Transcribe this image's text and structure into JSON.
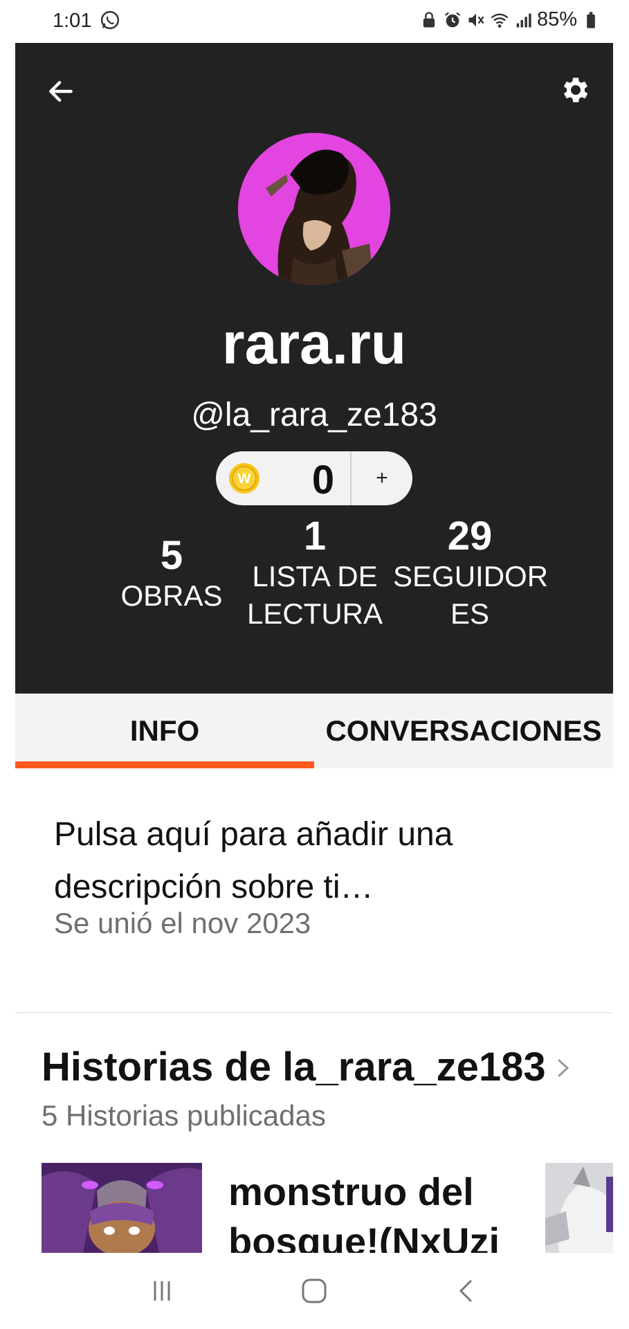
{
  "status_bar": {
    "time": "1:01",
    "battery": "85%",
    "icons": [
      "whatsapp-icon",
      "lock-icon",
      "alarm-icon",
      "mute-icon",
      "wifi-icon",
      "signal-icon",
      "battery-icon"
    ]
  },
  "header": {
    "back_icon": "arrow-left-icon",
    "settings_icon": "gear-icon",
    "display_name": "rara.ru",
    "handle": "@la_rara_ze183",
    "coins": {
      "value": "0",
      "add_label": "+",
      "icon": "coin-icon",
      "coin_letter": "W"
    },
    "stats": [
      {
        "number": "5",
        "label_lines": [
          "OBRAS"
        ]
      },
      {
        "number": "1",
        "label_lines": [
          "LISTA DE",
          "LECTURA"
        ]
      },
      {
        "number": "29",
        "label_lines": [
          "SEGUIDOR",
          "ES"
        ]
      }
    ]
  },
  "tabs": [
    {
      "label": "INFO",
      "active": true
    },
    {
      "label": "CONVERSACIONES",
      "active": false
    }
  ],
  "about": {
    "prompt_line1": "Pulsa aquí para añadir una",
    "prompt_line2": "descripción sobre ti…",
    "joined": "Se unió el nov 2023"
  },
  "stories": {
    "title": "Historias de la_rara_ze183",
    "count": "5 Historias publicadas",
    "first_story_line1": "monstruo del",
    "first_story_line2": "bosque!(NxUzi"
  },
  "colors": {
    "header_bg": "#222222",
    "accent": "#ff5a1f",
    "avatar_bg": "#e245e0",
    "coin": "#f5c518"
  },
  "navbar": {
    "icons": [
      "recents-icon",
      "home-icon",
      "back-nav-icon"
    ]
  }
}
